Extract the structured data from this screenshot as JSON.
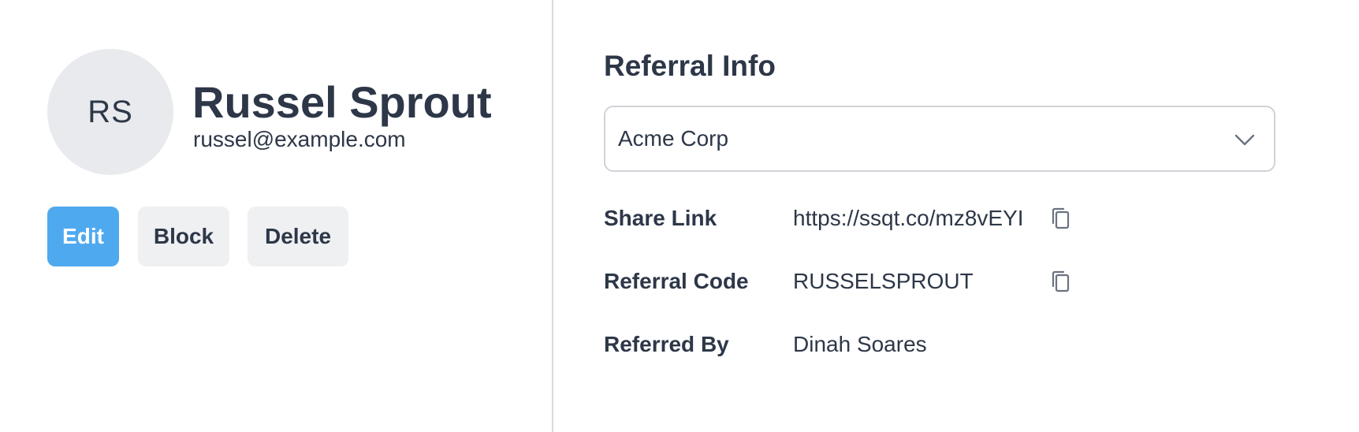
{
  "profile": {
    "initials": "RS",
    "name": "Russel Sprout",
    "email": "russel@example.com"
  },
  "actions": {
    "edit_label": "Edit",
    "block_label": "Block",
    "delete_label": "Delete"
  },
  "referral": {
    "title": "Referral Info",
    "selected_company": "Acme Corp",
    "rows": [
      {
        "label": "Share Link",
        "value": "https://ssqt.co/mz8vEYI",
        "icon": "copy-icon"
      },
      {
        "label": "Referral Code",
        "value": "RUSSELSPROUT",
        "icon": "copy-icon"
      },
      {
        "label": "Referred By",
        "value": "Dinah Soares"
      }
    ]
  },
  "colors": {
    "primary_button": "#4fa9ef",
    "secondary_button": "#eef0f2",
    "text": "#2d3748",
    "avatar_bg": "#e8eaed"
  }
}
